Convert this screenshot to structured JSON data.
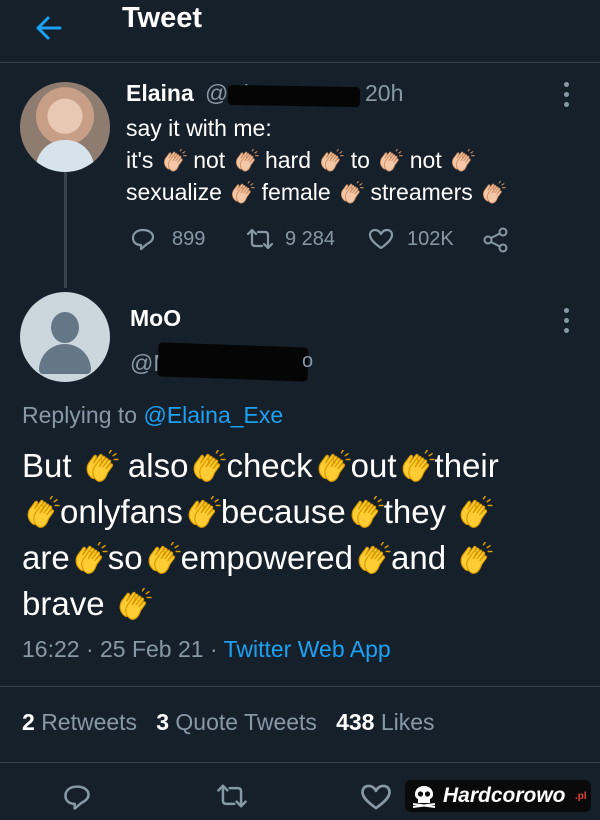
{
  "header": {
    "title": "Tweet"
  },
  "tweet1": {
    "name": "Elaina",
    "handle": "@El",
    "time": "20h",
    "lines": [
      {
        "words": [
          "say it with me:"
        ]
      },
      {
        "words": [
          "it's",
          "not",
          "hard",
          "to",
          "not"
        ]
      },
      {
        "words": [
          "sexualize",
          "female",
          "streamers"
        ]
      }
    ],
    "replies": "899",
    "retweets": "9 284",
    "likes": "102K"
  },
  "tweet2": {
    "name": "MoO",
    "handle": "@M",
    "handle_tail": "o",
    "replying_prefix": "Replying to",
    "replying_handle": "@Elaina_Exe",
    "lines": [
      [
        "But",
        "also",
        "check",
        "out",
        "their"
      ],
      [
        "onlyfans",
        "because",
        "they"
      ],
      [
        "are",
        "so",
        "empowered",
        "and"
      ],
      [
        "brave"
      ]
    ],
    "timestamp": "16:22 · 25 Feb 21 · ",
    "app": "Twitter Web App",
    "stats": {
      "retweets_count": "2",
      "retweets_label": "Retweets",
      "quotes_count": "3",
      "quotes_label": "Quote Tweets",
      "likes_count": "438",
      "likes_label": "Likes"
    }
  },
  "watermark": {
    "text": "Hardcorowo",
    "suffix": ".pl"
  },
  "colors": {
    "background": "#15202b",
    "accent": "#1da1f2",
    "muted": "#8899a6",
    "clap_light": "#f4c7a6",
    "clap_yellow": "#ffcc33"
  },
  "icons": [
    "back-arrow-icon",
    "more-icon",
    "reply-icon",
    "retweet-icon",
    "like-icon",
    "share-icon",
    "clap-emoji-icon",
    "skull-icon"
  ]
}
